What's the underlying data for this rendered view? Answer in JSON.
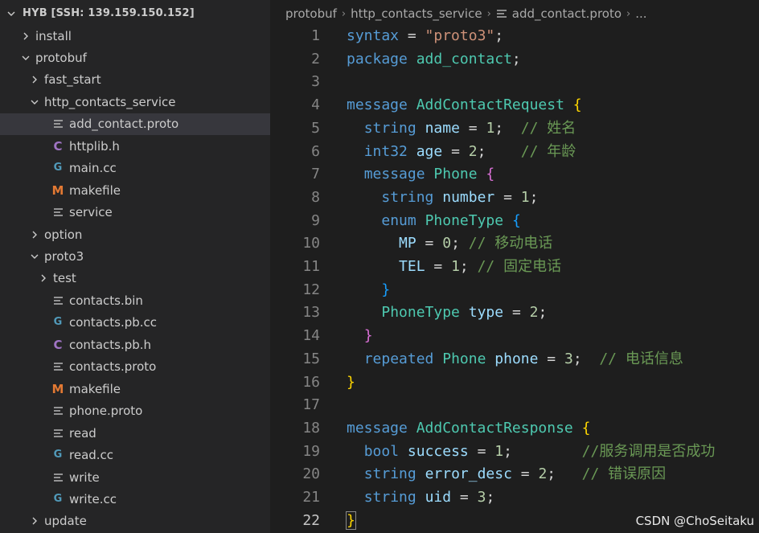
{
  "explorer": {
    "header": "HYB [SSH: 139.159.150.152]",
    "items": [
      {
        "label": "install",
        "kind": "folder",
        "depth": 1,
        "open": false
      },
      {
        "label": "protobuf",
        "kind": "folder",
        "depth": 1,
        "open": true
      },
      {
        "label": "fast_start",
        "kind": "folder",
        "depth": 2,
        "open": false
      },
      {
        "label": "http_contacts_service",
        "kind": "folder",
        "depth": 2,
        "open": true
      },
      {
        "label": "add_contact.proto",
        "kind": "txt",
        "depth": 3,
        "selected": true
      },
      {
        "label": "httplib.h",
        "kind": "c",
        "depth": 3
      },
      {
        "label": "main.cc",
        "kind": "cpp",
        "depth": 3
      },
      {
        "label": "makefile",
        "kind": "m",
        "depth": 3
      },
      {
        "label": "service",
        "kind": "txt",
        "depth": 3
      },
      {
        "label": "option",
        "kind": "folder",
        "depth": 2,
        "open": false
      },
      {
        "label": "proto3",
        "kind": "folder",
        "depth": 2,
        "open": true
      },
      {
        "label": "test",
        "kind": "folder",
        "depth": 3,
        "open": false
      },
      {
        "label": "contacts.bin",
        "kind": "txt",
        "depth": 3
      },
      {
        "label": "contacts.pb.cc",
        "kind": "cpp",
        "depth": 3
      },
      {
        "label": "contacts.pb.h",
        "kind": "c",
        "depth": 3
      },
      {
        "label": "contacts.proto",
        "kind": "txt",
        "depth": 3
      },
      {
        "label": "makefile",
        "kind": "m",
        "depth": 3
      },
      {
        "label": "phone.proto",
        "kind": "txt",
        "depth": 3
      },
      {
        "label": "read",
        "kind": "txt",
        "depth": 3
      },
      {
        "label": "read.cc",
        "kind": "cpp",
        "depth": 3
      },
      {
        "label": "write",
        "kind": "txt",
        "depth": 3
      },
      {
        "label": "write.cc",
        "kind": "cpp",
        "depth": 3
      },
      {
        "label": "update",
        "kind": "folder",
        "depth": 2,
        "open": false
      }
    ]
  },
  "breadcrumb": {
    "parts": [
      "protobuf",
      "http_contacts_service",
      "add_contact.proto",
      "..."
    ]
  },
  "editor": {
    "active_line": 22,
    "lines": [
      [
        [
          "k",
          "syntax"
        ],
        [
          "p",
          " = "
        ],
        [
          "s",
          "\"proto3\""
        ],
        [
          "p",
          ";"
        ]
      ],
      [
        [
          "k",
          "package"
        ],
        [
          "p",
          " "
        ],
        [
          "t",
          "add_contact"
        ],
        [
          "p",
          ";"
        ]
      ],
      [],
      [
        [
          "k",
          "message"
        ],
        [
          "p",
          " "
        ],
        [
          "t",
          "AddContactRequest"
        ],
        [
          "p",
          " "
        ],
        [
          "b1",
          "{"
        ]
      ],
      [
        [
          "p",
          "  "
        ],
        [
          "k",
          "string"
        ],
        [
          "p",
          " "
        ],
        [
          "v",
          "name"
        ],
        [
          "p",
          " = "
        ],
        [
          "n",
          "1"
        ],
        [
          "p",
          ";  "
        ],
        [
          "c",
          "// 姓名"
        ]
      ],
      [
        [
          "p",
          "  "
        ],
        [
          "k",
          "int32"
        ],
        [
          "p",
          " "
        ],
        [
          "v",
          "age"
        ],
        [
          "p",
          " = "
        ],
        [
          "n",
          "2"
        ],
        [
          "p",
          ";    "
        ],
        [
          "c",
          "// 年龄"
        ]
      ],
      [
        [
          "p",
          "  "
        ],
        [
          "k",
          "message"
        ],
        [
          "p",
          " "
        ],
        [
          "t",
          "Phone"
        ],
        [
          "p",
          " "
        ],
        [
          "b2",
          "{"
        ]
      ],
      [
        [
          "p",
          "    "
        ],
        [
          "k",
          "string"
        ],
        [
          "p",
          " "
        ],
        [
          "v",
          "number"
        ],
        [
          "p",
          " = "
        ],
        [
          "n",
          "1"
        ],
        [
          "p",
          ";"
        ]
      ],
      [
        [
          "p",
          "    "
        ],
        [
          "k",
          "enum"
        ],
        [
          "p",
          " "
        ],
        [
          "t",
          "PhoneType"
        ],
        [
          "p",
          " "
        ],
        [
          "b3",
          "{"
        ]
      ],
      [
        [
          "p",
          "      "
        ],
        [
          "v",
          "MP"
        ],
        [
          "p",
          " = "
        ],
        [
          "n",
          "0"
        ],
        [
          "p",
          "; "
        ],
        [
          "c",
          "// 移动电话"
        ]
      ],
      [
        [
          "p",
          "      "
        ],
        [
          "v",
          "TEL"
        ],
        [
          "p",
          " = "
        ],
        [
          "n",
          "1"
        ],
        [
          "p",
          "; "
        ],
        [
          "c",
          "// 固定电话"
        ]
      ],
      [
        [
          "p",
          "    "
        ],
        [
          "b3",
          "}"
        ]
      ],
      [
        [
          "p",
          "    "
        ],
        [
          "t",
          "PhoneType"
        ],
        [
          "p",
          " "
        ],
        [
          "v",
          "type"
        ],
        [
          "p",
          " = "
        ],
        [
          "n",
          "2"
        ],
        [
          "p",
          ";"
        ]
      ],
      [
        [
          "p",
          "  "
        ],
        [
          "b2",
          "}"
        ]
      ],
      [
        [
          "p",
          "  "
        ],
        [
          "k",
          "repeated"
        ],
        [
          "p",
          " "
        ],
        [
          "t",
          "Phone"
        ],
        [
          "p",
          " "
        ],
        [
          "v",
          "phone"
        ],
        [
          "p",
          " = "
        ],
        [
          "n",
          "3"
        ],
        [
          "p",
          ";  "
        ],
        [
          "c",
          "// 电话信息"
        ]
      ],
      [
        [
          "b1",
          "}"
        ]
      ],
      [],
      [
        [
          "k",
          "message"
        ],
        [
          "p",
          " "
        ],
        [
          "t",
          "AddContactResponse"
        ],
        [
          "p",
          " "
        ],
        [
          "b1",
          "{"
        ]
      ],
      [
        [
          "p",
          "  "
        ],
        [
          "k",
          "bool"
        ],
        [
          "p",
          " "
        ],
        [
          "v",
          "success"
        ],
        [
          "p",
          " = "
        ],
        [
          "n",
          "1"
        ],
        [
          "p",
          ";        "
        ],
        [
          "c",
          "//服务调用是否成功"
        ]
      ],
      [
        [
          "p",
          "  "
        ],
        [
          "k",
          "string"
        ],
        [
          "p",
          " "
        ],
        [
          "v",
          "error_desc"
        ],
        [
          "p",
          " = "
        ],
        [
          "n",
          "2"
        ],
        [
          "p",
          ";   "
        ],
        [
          "c",
          "// 错误原因"
        ]
      ],
      [
        [
          "p",
          "  "
        ],
        [
          "k",
          "string"
        ],
        [
          "p",
          " "
        ],
        [
          "v",
          "uid"
        ],
        [
          "p",
          " = "
        ],
        [
          "n",
          "3"
        ],
        [
          "p",
          ";"
        ]
      ],
      [
        [
          "b1",
          "}"
        ]
      ]
    ]
  },
  "watermark": "CSDN @ChoSeitaku",
  "colors": {
    "explorer_bg": "#252526",
    "editor_bg": "#1e1e1e",
    "selected_row": "#37373d",
    "keyword": "#569cd6",
    "type": "#4ec9b0",
    "variable": "#9cdcfe",
    "string": "#ce9178",
    "number": "#b5cea8",
    "comment": "#6a9955",
    "bracket_1": "#ffd700",
    "bracket_2": "#da70d6",
    "bracket_3": "#179fff"
  },
  "icons": {
    "folder_closed": "chevron-right-icon",
    "folder_open": "chevron-down-icon",
    "txt": "lines-file-icon",
    "cpp": "cpp-file-icon",
    "c": "c-file-icon",
    "m": "makefile-icon"
  }
}
